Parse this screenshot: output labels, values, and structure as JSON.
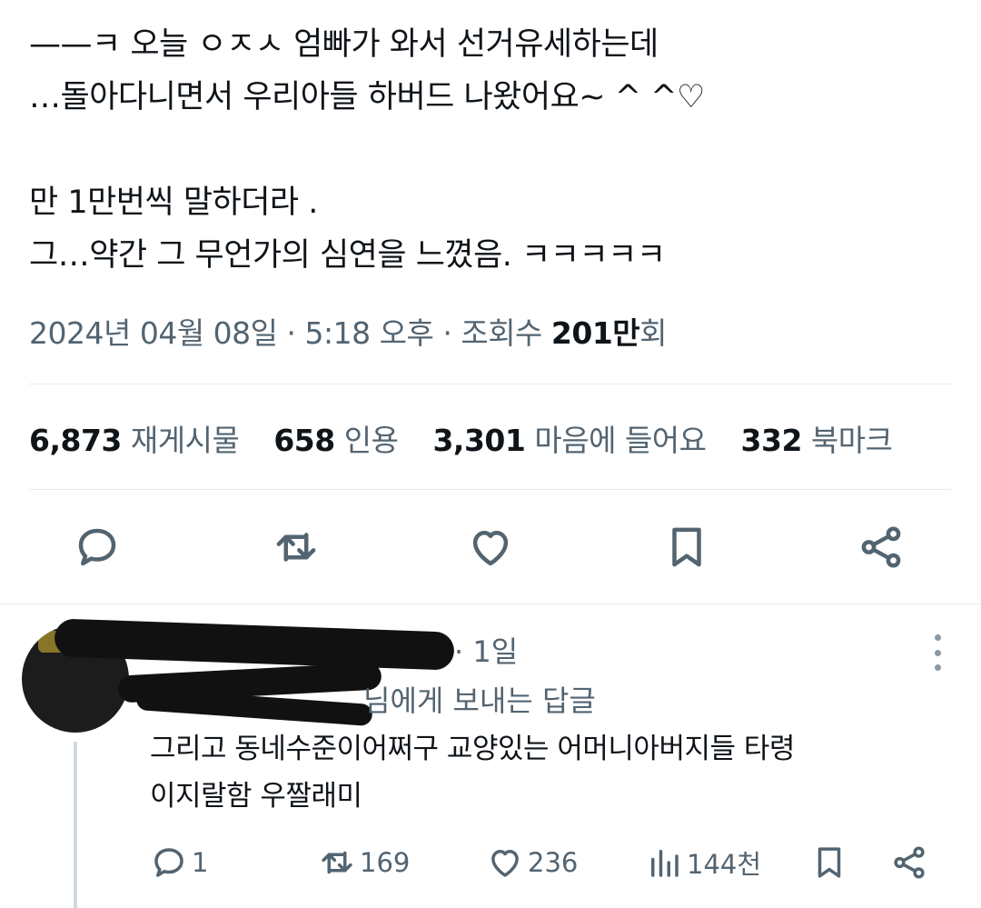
{
  "tweet": {
    "lines": [
      "——ㅋ 오늘 ㅇㅈㅅ 엄빠가 와서 선거유세하는데",
      "…돌아다니면서 우리아들 하버드 나왔어요~ ^ ^♡",
      "",
      "만 1만번씩 말하더라 .",
      "그…약간 그 무언가의 심연을 느꼈음. ㅋㅋㅋㅋㅋ"
    ],
    "date": "2024년 04월 08일",
    "time": "5:18 오후",
    "views_label": "조회수",
    "views_count": "201만",
    "views_suffix": "회"
  },
  "stats": {
    "retweets": {
      "num": "6,873",
      "label": "재게시물"
    },
    "quotes": {
      "num": "658",
      "label": "인용"
    },
    "likes": {
      "num": "3,301",
      "label": "마음에 들어요"
    },
    "bookmarks": {
      "num": "332",
      "label": "북마크"
    }
  },
  "actions": {
    "icons": [
      "reply-icon",
      "retweet-icon",
      "heart-icon",
      "bookmark-icon",
      "share-icon"
    ]
  },
  "reply": {
    "time_ago": "1일",
    "replying_to": "님에게 보내는 답글",
    "text_lines": [
      "그리고 동네수준이어쩌구 교양있는 어머니아버지들 타령",
      "이지랄함 우짤래미"
    ],
    "counts": {
      "replies": "1",
      "retweets": "169",
      "likes": "236",
      "views": "144천"
    }
  },
  "colors": {
    "text": "#0f1419",
    "secondary": "#536471",
    "divider": "#e6ecf0"
  }
}
